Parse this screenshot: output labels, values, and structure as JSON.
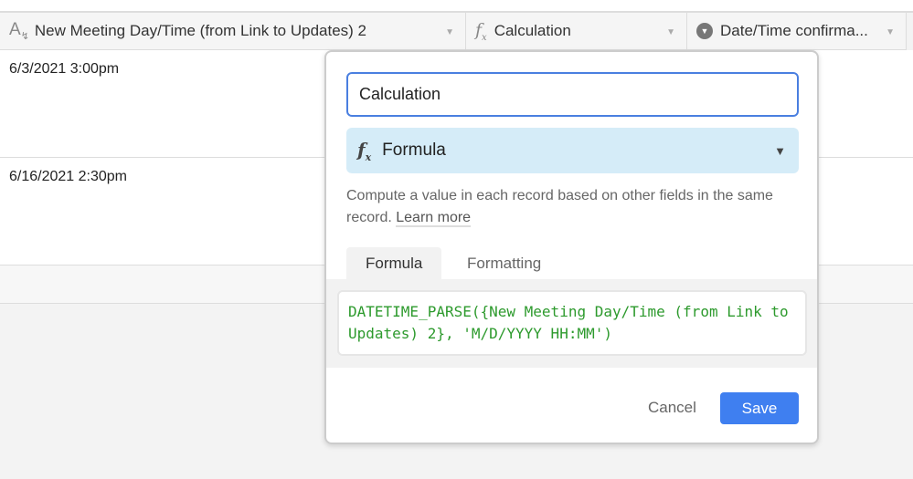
{
  "columns": [
    {
      "icon": "text-lookup-icon",
      "label": "New Meeting Day/Time (from Link to Updates) 2"
    },
    {
      "icon": "formula-icon",
      "label": "Calculation"
    },
    {
      "icon": "single-select-icon",
      "label": "Date/Time confirma..."
    }
  ],
  "rows": [
    {
      "value": "6/3/2021 3:00pm"
    },
    {
      "value": "6/16/2021 2:30pm"
    }
  ],
  "dialog": {
    "field_name": "Calculation",
    "field_type": "Formula",
    "description": "Compute a value in each record based on other fields in the same record.",
    "learn_more": "Learn more",
    "tabs": [
      "Formula",
      "Formatting"
    ],
    "formula": "DATETIME_PARSE({New Meeting Day/Time (from Link to Updates) 2}, 'M/D/YYYY HH:MM')",
    "cancel": "Cancel",
    "save": "Save"
  },
  "colors": {
    "accent": "#3f7ff0",
    "formula_text": "#2d9a2d",
    "type_bg": "#d5ecf8"
  }
}
